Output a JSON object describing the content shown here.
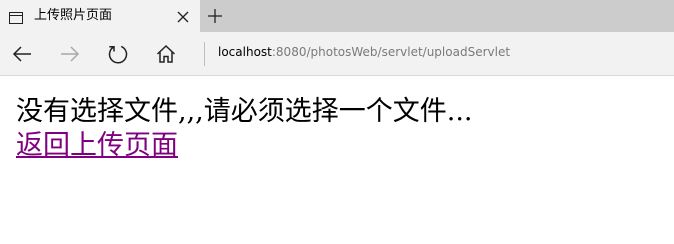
{
  "tab": {
    "icon": "page-icon",
    "title": "上传照片页面",
    "close_icon": "close-icon"
  },
  "new_tab_icon": "plus-icon",
  "toolbar": {
    "back_icon": "arrow-left-icon",
    "forward_icon": "arrow-right-icon",
    "refresh_icon": "refresh-icon",
    "home_icon": "home-icon",
    "url_host": "localhost",
    "url_rest": ":8080/photosWeb/servlet/uploadServlet"
  },
  "content": {
    "message": "没有选择文件,,,请必须选择一个文件...",
    "link_text": "返回上传页面",
    "link_color": "#800080"
  }
}
